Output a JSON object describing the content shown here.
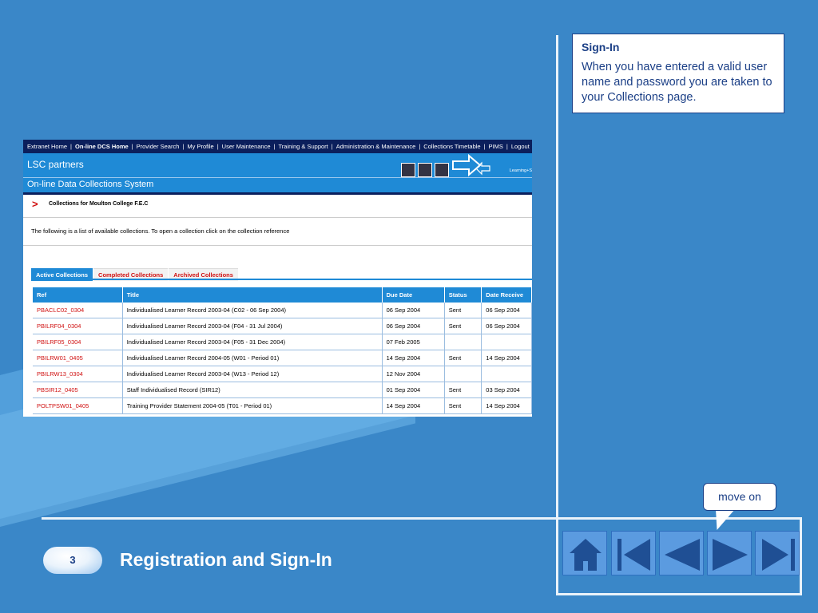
{
  "callout": {
    "title": "Sign-In",
    "body": "When you have entered a valid user name and password you are taken to your Collections page."
  },
  "move_on": "move on",
  "slide": {
    "number": "3",
    "title": "Registration and Sign-In"
  },
  "nav_icons": [
    "home-icon",
    "first-icon",
    "previous-icon",
    "next-icon",
    "last-icon"
  ],
  "screenshot": {
    "topnav": [
      {
        "label": "Extranet Home",
        "active": false
      },
      {
        "label": "On-line DCS Home",
        "active": true
      },
      {
        "label": "Provider Search",
        "active": false
      },
      {
        "label": "My Profile",
        "active": false
      },
      {
        "label": "User Maintenance",
        "active": false
      },
      {
        "label": "Training & Support",
        "active": false
      },
      {
        "label": "Administration & Maintenance",
        "active": false
      },
      {
        "label": "Collections Timetable",
        "active": false
      },
      {
        "label": "PIMS",
        "active": false
      },
      {
        "label": "Logout",
        "active": false
      }
    ],
    "brand": "LSC partners",
    "learn_text": "Learning+S",
    "system_title": "On-line Data Collections System",
    "chevron": ">",
    "collections_title": "Collections for Moulton College F.E.C",
    "intro": "The following is a list of available collections. To open a collection click on the collection reference",
    "tabs": [
      {
        "label": "Active Collections",
        "active": true
      },
      {
        "label": "Completed Collections",
        "active": false
      },
      {
        "label": "Archived Collections",
        "active": false
      }
    ],
    "table": {
      "headers": [
        "Ref",
        "Title",
        "Due Date",
        "Status",
        "Date Receive"
      ],
      "rows": [
        [
          "PBACLC02_0304",
          "Individualised Learner Record 2003-04 (C02 - 06 Sep 2004)",
          "06 Sep 2004",
          "Sent",
          "06 Sep 2004"
        ],
        [
          "PBILRF04_0304",
          "Individualised Learner Record 2003-04 (F04 - 31 Jul 2004)",
          "06 Sep 2004",
          "Sent",
          "06 Sep 2004"
        ],
        [
          "PBILRF05_0304",
          "Individualised Learner Record 2003-04 (F05 - 31 Dec 2004)",
          "07 Feb 2005",
          "",
          ""
        ],
        [
          "PBILRW01_0405",
          "Individualised Learner Record 2004-05 (W01 - Period 01)",
          "14 Sep 2004",
          "Sent",
          "14 Sep 2004"
        ],
        [
          "PBILRW13_0304",
          "Individualised Learner Record 2003-04 (W13 - Period 12)",
          "12 Nov 2004",
          "",
          ""
        ],
        [
          "PBSIR12_0405",
          "Staff Individualised Record (SIR12)",
          "01 Sep 2004",
          "Sent",
          "03 Sep 2004"
        ],
        [
          "POLTPSW01_0405",
          "Training Provider Statement 2004-05 (T01 - Period 01)",
          "14 Sep 2004",
          "Sent",
          "14 Sep 2004"
        ]
      ]
    }
  }
}
